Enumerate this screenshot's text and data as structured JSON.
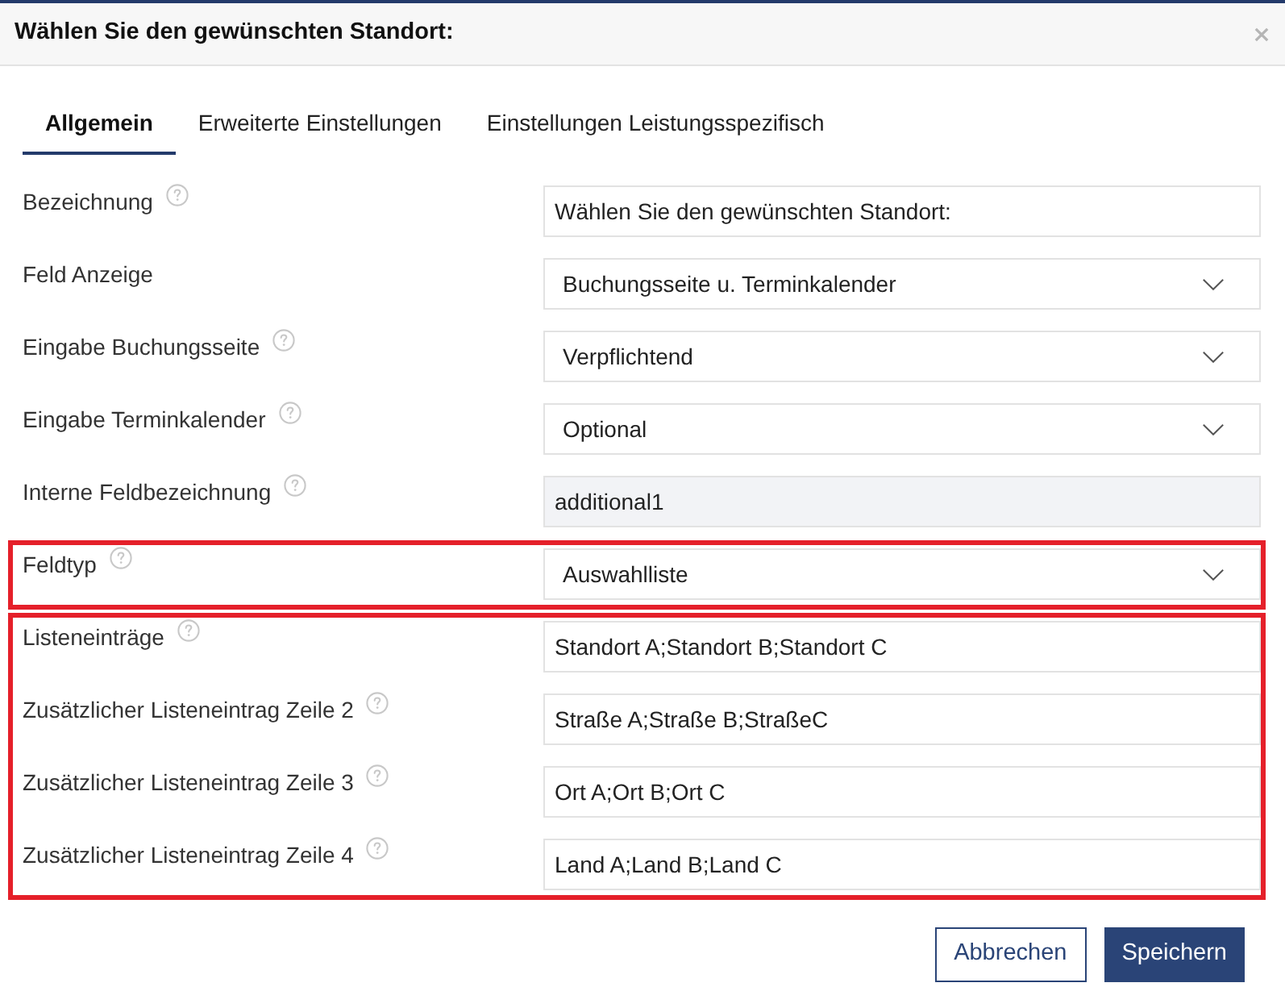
{
  "dialog": {
    "title": "Wählen Sie den gewünschten Standort:"
  },
  "tabs": [
    {
      "label": "Allgemein",
      "selected": true
    },
    {
      "label": "Erweiterte Einstellungen",
      "selected": false
    },
    {
      "label": "Einstellungen Leistungsspezifisch",
      "selected": false
    }
  ],
  "sections": [
    {
      "highlighted": false,
      "fields": [
        {
          "label": "Bezeichnung",
          "help": true,
          "kind": "text",
          "value": "Wählen Sie den gewünschten Standort:"
        },
        {
          "label": "Feld Anzeige",
          "help": false,
          "kind": "select",
          "value": "Buchungsseite u. Terminkalender"
        },
        {
          "label": "Eingabe Buchungsseite",
          "help": true,
          "kind": "select",
          "value": "Verpflichtend"
        },
        {
          "label": "Eingabe Terminkalender",
          "help": true,
          "kind": "select",
          "value": "Optional"
        },
        {
          "label": "Interne Feldbezeichnung",
          "help": true,
          "kind": "readonly",
          "value": "additional1"
        }
      ]
    },
    {
      "highlighted": true,
      "fields": [
        {
          "label": "Feldtyp",
          "help": true,
          "kind": "select",
          "value": "Auswahlliste"
        }
      ]
    },
    {
      "highlighted": true,
      "fields": [
        {
          "label": "Listeneinträge",
          "help": true,
          "kind": "text",
          "value": "Standort A;Standort B;Standort C"
        },
        {
          "label": "Zusätzlicher Listeneintrag Zeile 2",
          "help": true,
          "kind": "text",
          "value": "Straße A;Straße B;StraßeC"
        },
        {
          "label": "Zusätzlicher Listeneintrag Zeile 3",
          "help": true,
          "kind": "text",
          "value": "Ort A;Ort B;Ort C"
        },
        {
          "label": "Zusätzlicher Listeneintrag Zeile 4",
          "help": true,
          "kind": "text",
          "value": "Land A;Land B;Land C"
        }
      ]
    }
  ],
  "buttons": [
    {
      "label": "Abbrechen",
      "kind": "secondary"
    },
    {
      "label": "Speichern",
      "kind": "primary"
    }
  ]
}
